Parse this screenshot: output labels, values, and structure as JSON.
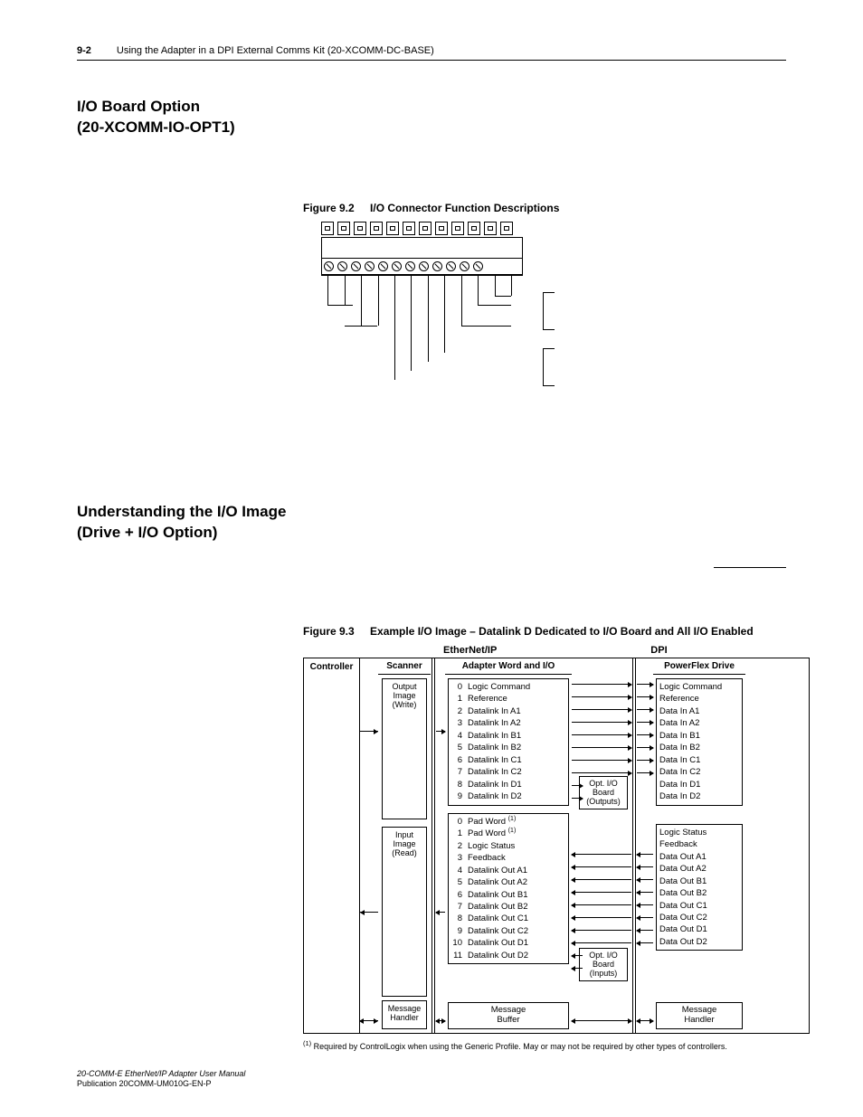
{
  "header": {
    "page_number": "9-2",
    "chapter": "Using the Adapter in a DPI External Comms Kit (20-XCOMM-DC-BASE)"
  },
  "section1": {
    "title_line1": "I/O Board Option",
    "title_line2": "(20-XCOMM-IO-OPT1)"
  },
  "figure92": {
    "label": "Figure 9.2",
    "caption": "I/O Connector Function Descriptions"
  },
  "section2": {
    "title_line1": "Understanding the I/O Image",
    "title_line2": "(Drive + I/O Option)"
  },
  "figure93": {
    "label": "Figure 9.3",
    "caption": "Example I/O Image – Datalink D Dedicated to I/O Board and All I/O Enabled",
    "proto_left": "EtherNet/IP",
    "proto_right": "DPI",
    "columns": {
      "controller": "Controller",
      "scanner": "Scanner",
      "adapter": "Adapter Word and I/O",
      "drive": "PowerFlex Drive"
    },
    "scanner": {
      "output_l1": "Output",
      "output_l2": "Image",
      "output_l3": "(Write)",
      "input_l1": "Input",
      "input_l2": "Image",
      "input_l3": "(Read)",
      "msg_l1": "Message",
      "msg_l2": "Handler"
    },
    "adapter_out": [
      {
        "n": "0",
        "t": "Logic Command"
      },
      {
        "n": "1",
        "t": "Reference"
      },
      {
        "n": "2",
        "t": "Datalink In A1"
      },
      {
        "n": "3",
        "t": "Datalink In A2"
      },
      {
        "n": "4",
        "t": "Datalink In B1"
      },
      {
        "n": "5",
        "t": "Datalink In B2"
      },
      {
        "n": "6",
        "t": "Datalink In C1"
      },
      {
        "n": "7",
        "t": "Datalink In C2"
      },
      {
        "n": "8",
        "t": "Datalink In D1"
      },
      {
        "n": "9",
        "t": "Datalink In D2"
      }
    ],
    "adapter_in": [
      {
        "n": "0",
        "t": "Pad Word",
        "sup": "(1)"
      },
      {
        "n": "1",
        "t": "Pad Word",
        "sup": "(1)"
      },
      {
        "n": "2",
        "t": "Logic Status"
      },
      {
        "n": "3",
        "t": "Feedback"
      },
      {
        "n": "4",
        "t": "Datalink Out A1"
      },
      {
        "n": "5",
        "t": "Datalink Out A2"
      },
      {
        "n": "6",
        "t": "Datalink Out B1"
      },
      {
        "n": "7",
        "t": "Datalink Out B2"
      },
      {
        "n": "8",
        "t": "Datalink Out C1"
      },
      {
        "n": "9",
        "t": "Datalink Out C2"
      },
      {
        "n": "10",
        "t": "Datalink Out D1"
      },
      {
        "n": "11",
        "t": "Datalink Out D2"
      }
    ],
    "adapter_msg_l1": "Message",
    "adapter_msg_l2": "Buffer",
    "opt_out_l1": "Opt. I/O",
    "opt_out_l2": "Board",
    "opt_out_l3": "(Outputs)",
    "opt_in_l1": "Opt. I/O",
    "opt_in_l2": "Board",
    "opt_in_l3": "(Inputs)",
    "drive_out": [
      "Logic Command",
      "Reference",
      "Data In A1",
      "Data In A2",
      "Data In B1",
      "Data In B2",
      "Data In C1",
      "Data In C2",
      "Data In D1",
      "Data In D2"
    ],
    "drive_in": [
      "Logic Status",
      "Feedback",
      "Data Out A1",
      "Data Out A2",
      "Data Out B1",
      "Data Out B2",
      "Data Out C1",
      "Data Out C2",
      "Data Out D1",
      "Data Out D2"
    ],
    "drive_msg_l1": "Message",
    "drive_msg_l2": "Handler"
  },
  "footnote": {
    "marker": "(1)",
    "text": " Required by ControlLogix when using the Generic Profile. May or may not be required by other types of controllers."
  },
  "footer": {
    "line1": "20-COMM-E EtherNet/IP Adapter User Manual",
    "line2": "Publication 20COMM-UM010G-EN-P"
  }
}
